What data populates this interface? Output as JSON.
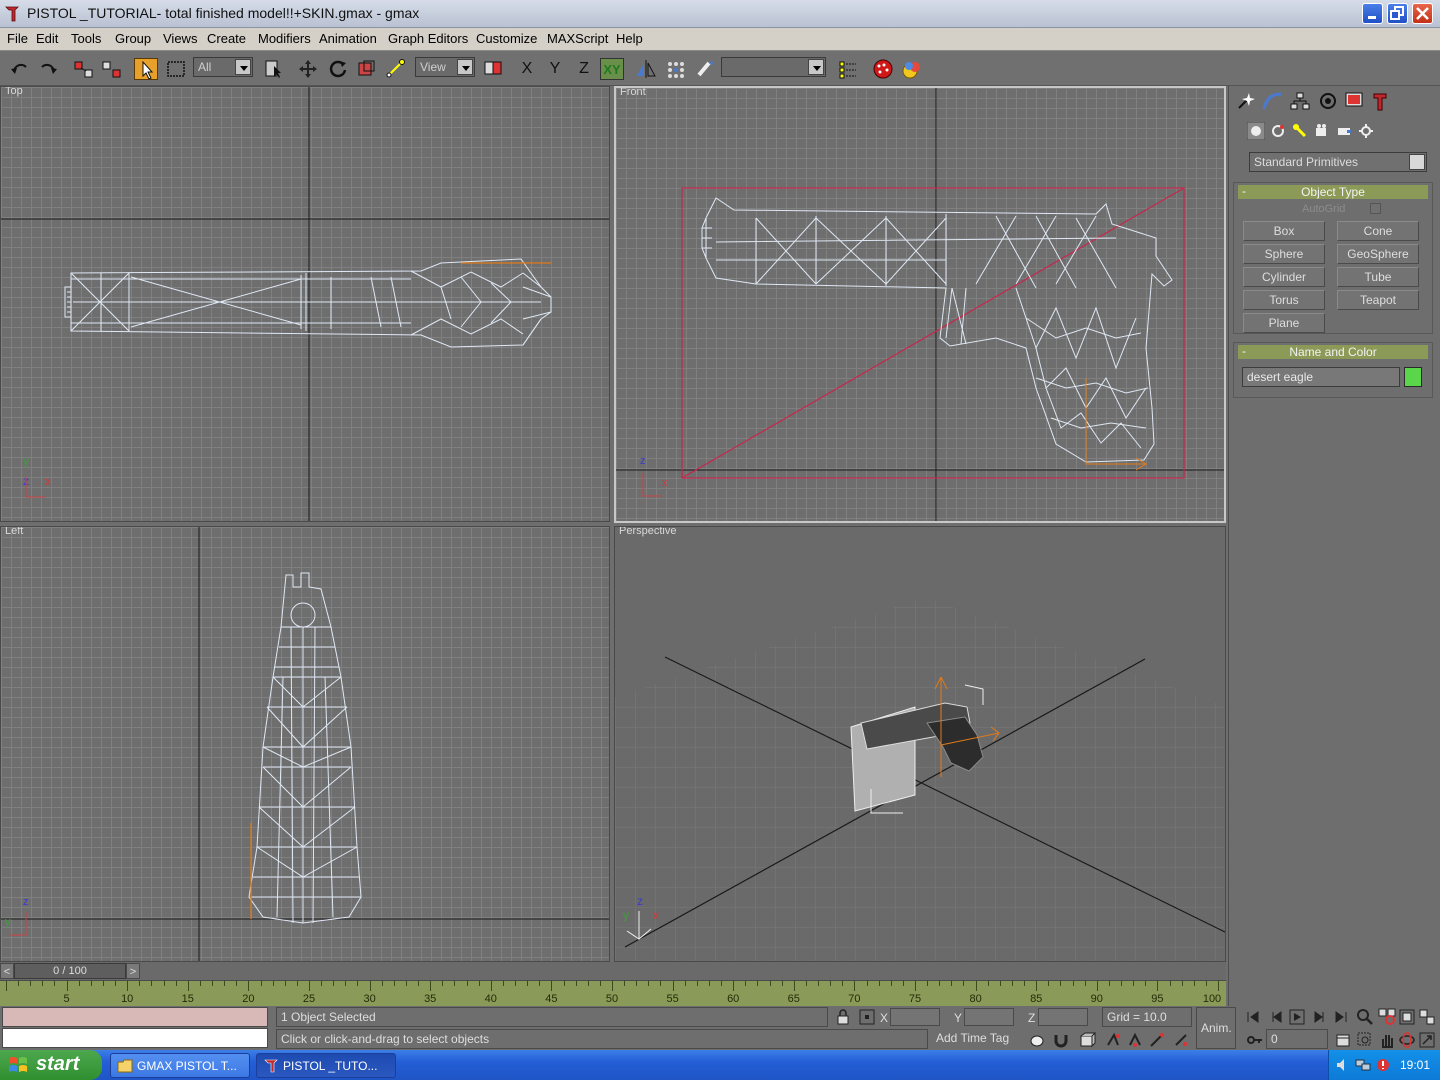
{
  "window": {
    "title": "PISTOL _TUTORIAL- total finished model!!+SKIN.gmax - gmax"
  },
  "menu": [
    "File",
    "Edit",
    "Tools",
    "Group",
    "Views",
    "Create",
    "Modifiers",
    "Animation",
    "Graph Editors",
    "Customize",
    "MAXScript",
    "Help"
  ],
  "toolbar": {
    "selection_filter": "All",
    "ref_coord": "View",
    "named_selection": "",
    "constraint_x": "X",
    "constraint_y": "Y",
    "constraint_z": "Z",
    "constraint_xy": "XY"
  },
  "viewports": {
    "top": {
      "label": "Top",
      "axis_x": "x",
      "axis_y": "y",
      "axis_z": "z"
    },
    "front": {
      "label": "Front",
      "axis_x": "x",
      "axis_z": "z"
    },
    "left": {
      "label": "Left",
      "axis_y": "y",
      "axis_z": "z"
    },
    "perspective": {
      "label": "Perspective",
      "axis_x": "x",
      "axis_y": "y",
      "axis_z": "z"
    }
  },
  "command_panel": {
    "category_dropdown": "Standard Primitives",
    "object_type": {
      "header": "Object Type",
      "autogrid_label": "AutoGrid",
      "buttons": [
        "Box",
        "Cone",
        "Sphere",
        "GeoSphere",
        "Cylinder",
        "Tube",
        "Torus",
        "Teapot",
        "Plane"
      ]
    },
    "name_and_color": {
      "header": "Name and Color",
      "object_name": "desert eagle",
      "color": "#5bd64a"
    },
    "rollout_minus": "-"
  },
  "timeline": {
    "frame_display": "0 / 100",
    "left_arrow": "<",
    "right_arrow": ">",
    "ticks": [
      "5",
      "10",
      "15",
      "20",
      "25",
      "30",
      "35",
      "40",
      "45",
      "50",
      "55",
      "60",
      "65",
      "70",
      "75",
      "80",
      "85",
      "90",
      "95",
      "100"
    ]
  },
  "status": {
    "selection_text": "1 Object Selected",
    "prompt_text": "Click or click-and-drag to select objects",
    "x_label": "X",
    "y_label": "Y",
    "z_label": "Z",
    "grid_text": "Grid = 10.0",
    "add_time_tag": "Add Time Tag",
    "anim_button": "Anim.",
    "frame_field": "0"
  },
  "taskbar": {
    "start_label": "start",
    "tasks": [
      "GMAX PISTOL T...",
      "PISTOL _TUTO..."
    ],
    "clock": "19:01"
  },
  "colors": {
    "accent_active_tool": "#e7a02a",
    "rollout_header": "#8c9a58",
    "trackbar": "#8a9a58",
    "wireframe": "#dfe8f4",
    "selection_box": "#c8264e"
  }
}
